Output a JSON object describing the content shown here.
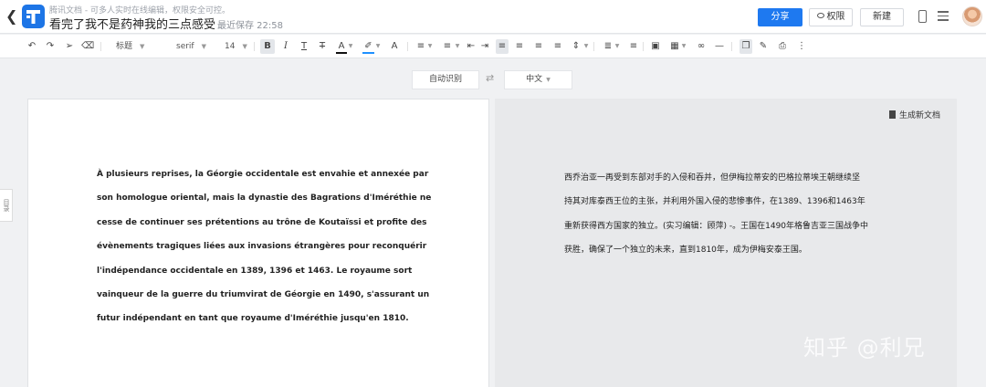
{
  "header": {
    "app_name": "腾讯文档 - 可多人实时在线编辑，权限安全可控。",
    "doc_title": "看完了我不是药神我的三点感受",
    "save_status": "最近保存 22:58",
    "share_label": "分享",
    "permission_label": "权限",
    "new_label": "新建"
  },
  "toolbar": {
    "style_label": "标题",
    "font_label": "serif",
    "size_label": "14",
    "bold": "B",
    "italic": "I",
    "underline_t": "T",
    "strike_t": "T",
    "font_color": "A",
    "highlight": "A"
  },
  "lang": {
    "source": "自动识别",
    "target": "中文"
  },
  "side": {
    "outline_label": "目录"
  },
  "source_lines": [
    "À plusieurs reprises, la Géorgie occidentale est envahie et annexée par",
    "son homologue oriental, mais la dynastie des Bagrations d'Iméréthie ne",
    "cesse de continuer ses prétentions au trône de Koutaïssi et profite des",
    "évènements tragiques liées aux invasions étrangères pour reconquérir",
    "l'indépendance occidentale en 1389, 1396 et 1463. Le royaume sort",
    "vainqueur de la guerre du triumvirat de Géorgie en 1490, s'assurant un",
    "futur indépendant en tant que royaume d'Iméréthie jusqu'en 1810."
  ],
  "translation": {
    "generate_label": "生成新文档",
    "lines": [
      "西乔治亚一再受到东部对手的入侵和吞并，但伊梅拉蒂安的巴格拉蒂埃王朝继续坚",
      "持其对库泰西王位的主张，并利用外国入侵的悲惨事件，在1389、1396和1463年",
      "重新获得西方国家的独立。(实习编辑：顾萍) -。王国在1490年格鲁吉亚三国战争中",
      "获胜，确保了一个独立的未来，直到1810年，成为伊梅安泰王国。"
    ]
  },
  "watermark": "知乎 @利兄",
  "colors": {
    "accent": "#1e79f0",
    "font_color_bar": "#111111",
    "highlight_bar": "#1e90ff"
  }
}
